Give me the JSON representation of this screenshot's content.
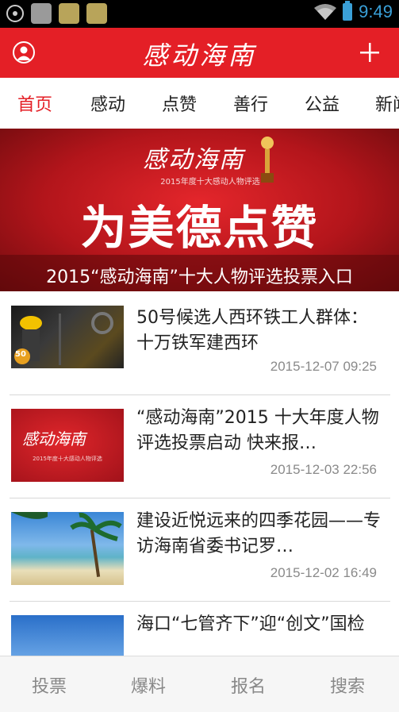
{
  "status_bar": {
    "time": "9:49",
    "icons": [
      "gps-icon",
      "app-notification-icon",
      "weather-app-icon",
      "weather-app-icon"
    ],
    "wifi_icon": "wifi-icon",
    "battery_icon": "battery-icon",
    "accent": "#3aa0d8"
  },
  "header": {
    "title": "感动海南",
    "user_icon": "user-icon",
    "add_icon": "plus-icon",
    "background": "#e41f26"
  },
  "tabs": [
    {
      "label": "首页",
      "active": true
    },
    {
      "label": "感动",
      "active": false
    },
    {
      "label": "点赞",
      "active": false
    },
    {
      "label": "善行",
      "active": false
    },
    {
      "label": "公益",
      "active": false
    },
    {
      "label": "新闻",
      "active": false
    }
  ],
  "banner": {
    "logo_text": "感动海南",
    "subtitle": "2015年度十大感动人物评选",
    "headline": "为美德点赞",
    "caption": "2015“感动海南”十大人物评选投票入口"
  },
  "news": [
    {
      "title": "50号候选人西环铁工人群体：十万铁军建西环",
      "date": "2015-12-07 09:25",
      "thumb_badge": "50"
    },
    {
      "title": "“感动海南”2015 十大年度人物评选投票启动 快来报…",
      "date": "2015-12-03 22:56",
      "thumb_logo": "感动海南",
      "thumb_sub": "2015年度十大感动人物评选"
    },
    {
      "title": "建设近悦远来的四季花园——专访海南省委书记罗…",
      "date": "2015-12-02 16:49"
    },
    {
      "title": "海口“七管齐下”迎“创文”国检",
      "date": ""
    }
  ],
  "bottom_nav": [
    "投票",
    "爆料",
    "报名",
    "搜索"
  ]
}
